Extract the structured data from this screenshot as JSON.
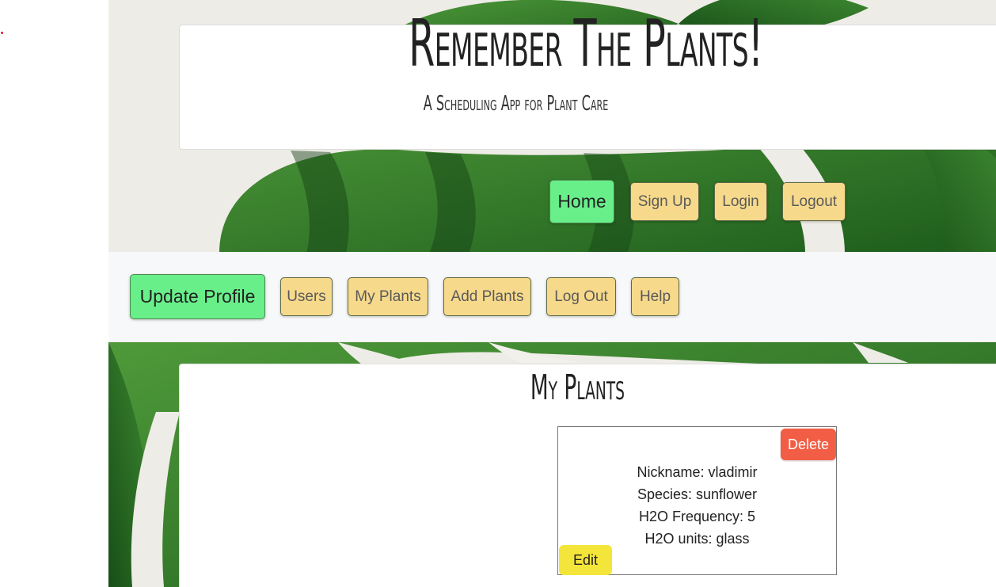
{
  "header": {
    "title": "Remember The Plants!",
    "subtitle": "A Scheduling App for Plant Care"
  },
  "main_nav": {
    "home": "Home",
    "sign_up": "Sign Up",
    "login": "Login",
    "logout": "Logout"
  },
  "profile_nav": {
    "update_profile": "Update Profile",
    "users": "Users",
    "my_plants": "My Plants",
    "add_plants": "Add Plants",
    "log_out": "Log Out",
    "help": "Help"
  },
  "section": {
    "title": "My Plants"
  },
  "plants": [
    {
      "nickname_label": "Nickname:",
      "nickname": "vladimir",
      "species_label": "Species:",
      "species": "sunflower",
      "frequency_label": "H2O Frequency:",
      "frequency": "5",
      "units_label": "H2O units:",
      "units": "glass",
      "delete_label": "Delete",
      "edit_label": "Edit"
    }
  ],
  "colors": {
    "active_button": "#68ef8a",
    "nav_button": "#f6d98b",
    "delete_button": "#f25d45",
    "edit_button": "#f4e53a",
    "leaf": "#2f7d2a"
  }
}
